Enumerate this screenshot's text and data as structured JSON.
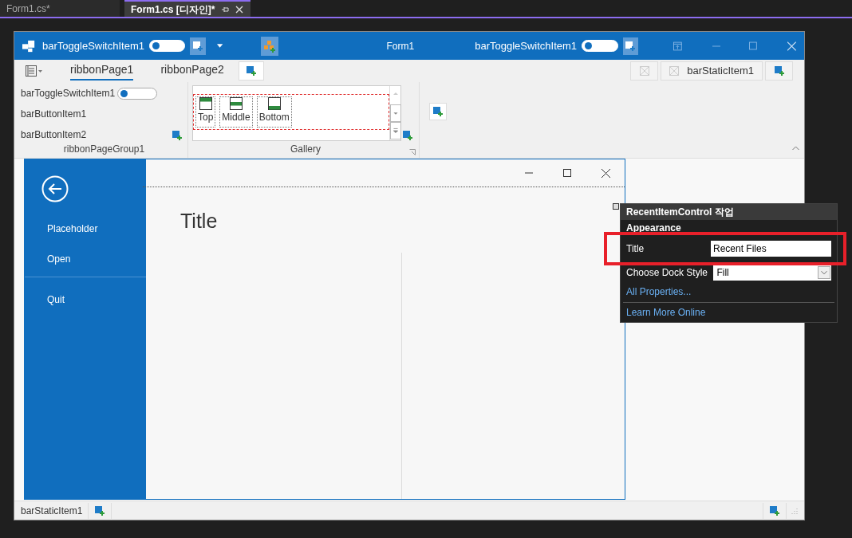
{
  "editor_tabs": [
    {
      "label": "Form1.cs*",
      "selected": false
    },
    {
      "label": "Form1.cs [디자인]*",
      "selected": true
    }
  ],
  "title_bar": {
    "left_toggle": {
      "label": "barToggleSwitchItem1",
      "on": false
    },
    "title": "Form1",
    "right_toggle": {
      "label": "barToggleSwitchItem1",
      "on": false
    }
  },
  "ribbon": {
    "pages": [
      {
        "label": "ribbonPage1",
        "selected": true
      },
      {
        "label": "ribbonPage2",
        "selected": false
      }
    ],
    "static_item": "barStaticItem1",
    "group": {
      "toggle": {
        "label": "barToggleSwitchItem1",
        "on": false
      },
      "buttons": [
        "barButtonItem1",
        "barButtonItem2"
      ],
      "caption": "ribbonPageGroup1"
    },
    "gallery": {
      "items": [
        {
          "label": "Top",
          "kind": "top"
        },
        {
          "label": "Middle",
          "kind": "middle"
        },
        {
          "label": "Bottom",
          "kind": "bottom"
        }
      ],
      "caption": "Gallery"
    }
  },
  "backstage": {
    "items": [
      "Placeholder",
      "Open",
      "Quit"
    ],
    "title": "Title"
  },
  "smart_tag": {
    "header": "RecentItemControl 작업",
    "section": "Appearance",
    "fields": [
      {
        "label": "Title",
        "value": "Recent Files",
        "kind": "text"
      },
      {
        "label": "Choose Dock Style",
        "value": "Fill",
        "kind": "dropdown"
      }
    ],
    "links": [
      "All Properties...",
      "Learn More Online"
    ]
  },
  "status_bar": {
    "item": "barStaticItem1"
  }
}
